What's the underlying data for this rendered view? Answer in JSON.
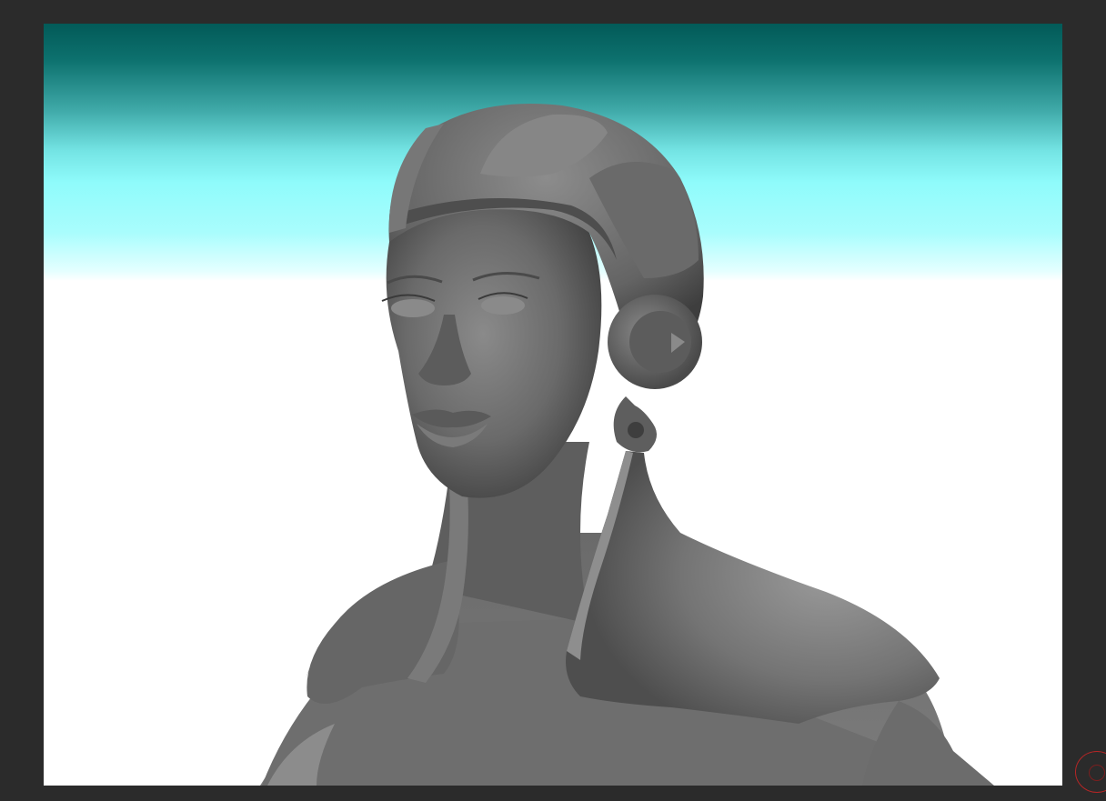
{
  "app": {
    "canvas": {
      "background_top_color": "#025a58",
      "background_mid_color": "#8ffbfb",
      "background_bottom_color": "#ffffff",
      "model_color": "#6e6e6e",
      "subject": "sculpted-female-bust-with-helmet"
    },
    "navigation_gizmo": {
      "icon": "orbit-gizmo-icon",
      "color": "#b52626"
    }
  }
}
